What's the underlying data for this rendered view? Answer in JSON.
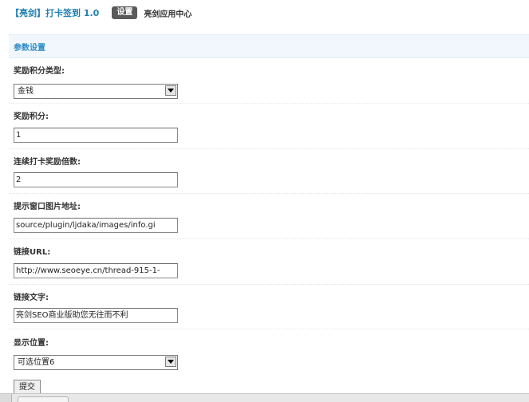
{
  "header": {
    "plugin_title": "【亮剑】打卡签到 1.0",
    "settings_tab": "设置",
    "app_center_link": "亮剑应用中心"
  },
  "section": {
    "title": "参数设置"
  },
  "fields": {
    "reward_type": {
      "label": "奖励积分类型:",
      "selected": "金钱"
    },
    "reward_points": {
      "label": "奖励积分:",
      "value": "1"
    },
    "streak_multiplier": {
      "label": "连续打卡奖励倍数:",
      "value": "2"
    },
    "popup_image_url": {
      "label": "提示窗口图片地址:",
      "value": "source/plugin/ljdaka/images/info.gi"
    },
    "link_url": {
      "label": "链接URL:",
      "value": "http://www.seoeye.cn/thread-915-1-"
    },
    "link_text": {
      "label": "链接文字:",
      "value": "亮剑SEO商业版助您无往而不利"
    },
    "display_position": {
      "label": "显示位置:",
      "selected": "可选位置6"
    }
  },
  "submit_label": "提交",
  "icons": {
    "dropdown": "chevron-down-icon"
  }
}
